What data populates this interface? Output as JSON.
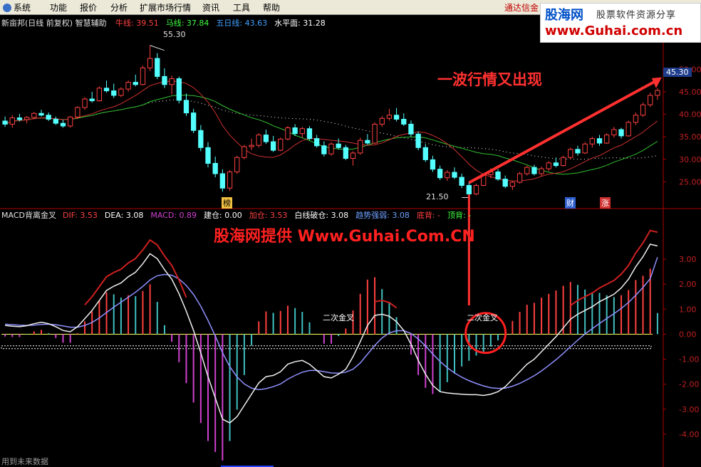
{
  "menu": {
    "items": [
      "系统",
      "功能",
      "报价",
      "分析",
      "扩展市场行情",
      "资讯",
      "工具",
      "帮助"
    ],
    "brand": "通达信金"
  },
  "watermark": {
    "line1": "股海网",
    "line2": "股票软件资源分享",
    "line3": "www.Guhai.com.cn"
  },
  "price_panel": {
    "stock": "新亩邦(日线 前复权) 智慧辅助",
    "indicators": [
      {
        "name": "牛线:",
        "value": "39.51",
        "color": "#ff4040"
      },
      {
        "name": "马线:",
        "value": "37.84",
        "color": "#40ff40"
      },
      {
        "name": "五日线:",
        "value": "43.63",
        "color": "#40a0ff"
      },
      {
        "name": "水平面:",
        "value": "31.28",
        "color": "#ffffff"
      }
    ],
    "high_label": "55.30",
    "low_label": "21.50",
    "current_price": "45.30",
    "marker_bang": "榜",
    "marker_cai": "财",
    "marker_zhang": "涨",
    "annotation": "一波行情又出现"
  },
  "macd_panel": {
    "title": "MACD背离金叉",
    "indicators": [
      {
        "name": "DIF:",
        "value": "3.53",
        "color": "#ff4040"
      },
      {
        "name": "DEA:",
        "value": "3.08",
        "color": "#ffffff"
      },
      {
        "name": "MACD:",
        "value": "0.89",
        "color": "#d040d0"
      },
      {
        "name": "建仓:",
        "value": "0.00",
        "color": "#ffffff"
      },
      {
        "name": "加仓:",
        "value": "3.53",
        "color": "#ff4040"
      },
      {
        "name": "白线破仓:",
        "value": "3.08",
        "color": "#ffffff"
      },
      {
        "name": "趋势强弱:",
        "value": "3.08",
        "color": "#6fa0ff"
      },
      {
        "name": "底背:",
        "value": "-",
        "color": "#ff4040"
      },
      {
        "name": "顶背:",
        "value": "-",
        "color": "#40ff40"
      }
    ],
    "label_cross1": "二次金叉",
    "label_cross2": "二次金叉",
    "annotation": "股海网提供 Www.Guhai.Com.CN"
  },
  "footer": "用到未来数据",
  "chart_data": [
    {
      "type": "candlestick",
      "ylim": [
        20,
        57
      ],
      "y_ticks": [
        25.0,
        30.0,
        35.0,
        40.0,
        45.0,
        50.0
      ],
      "ohlc": [
        [
          38.5,
          39.5,
          37.2,
          37.8
        ],
        [
          37.8,
          39.8,
          37,
          39.2
        ],
        [
          39.2,
          40.1,
          38.4,
          38.8
        ],
        [
          38.8,
          39.6,
          38,
          39.3
        ],
        [
          39.3,
          40.5,
          38.9,
          40.2
        ],
        [
          40.2,
          41.0,
          39.5,
          39.8
        ],
        [
          39.8,
          40.4,
          38.5,
          38.9
        ],
        [
          38.9,
          39.5,
          37.6,
          38.0
        ],
        [
          38.0,
          38.8,
          37.0,
          37.4
        ],
        [
          37.4,
          39.6,
          37.0,
          39.4
        ],
        [
          39.4,
          41.8,
          39.0,
          41.5
        ],
        [
          41.5,
          43.8,
          41.0,
          43.4
        ],
        [
          43.4,
          45.0,
          42.6,
          43.0
        ],
        [
          43.0,
          46.2,
          42.8,
          45.8
        ],
        [
          45.8,
          47.5,
          44.8,
          45.2
        ],
        [
          45.2,
          46.8,
          43.6,
          44.2
        ],
        [
          44.2,
          46.0,
          43.8,
          45.6
        ],
        [
          45.6,
          47.5,
          45.0,
          47.1
        ],
        [
          47.1,
          48.8,
          46.2,
          46.6
        ],
        [
          46.6,
          50.8,
          46.4,
          50.3
        ],
        [
          50.3,
          55.3,
          49.6,
          52.4
        ],
        [
          52.4,
          53.6,
          47.8,
          48.4
        ],
        [
          48.4,
          50.2,
          45.8,
          46.6
        ],
        [
          46.6,
          48.6,
          44.4,
          47.9
        ],
        [
          47.9,
          48.4,
          42.4,
          43.1
        ],
        [
          43.1,
          44.6,
          39.6,
          40.3
        ],
        [
          40.3,
          41.2,
          35.8,
          36.4
        ],
        [
          36.4,
          37.6,
          31.8,
          32.6
        ],
        [
          32.6,
          33.8,
          28.2,
          29.1
        ],
        [
          29.1,
          30.6,
          26.0,
          26.8
        ],
        [
          26.8,
          27.8,
          22.8,
          23.6
        ],
        [
          23.6,
          27.6,
          23.0,
          27.2
        ],
        [
          27.2,
          30.8,
          26.8,
          30.4
        ],
        [
          30.4,
          33.2,
          30.0,
          32.8
        ],
        [
          32.8,
          34.6,
          32.0,
          33.1
        ],
        [
          33.1,
          35.8,
          32.6,
          35.4
        ],
        [
          35.4,
          36.6,
          33.4,
          33.9
        ],
        [
          33.9,
          35.2,
          31.6,
          32.0
        ],
        [
          32.0,
          34.8,
          31.8,
          34.5
        ],
        [
          34.5,
          37.4,
          34.2,
          37.0
        ],
        [
          37.0,
          37.8,
          35.2,
          35.7
        ],
        [
          35.7,
          37.2,
          34.8,
          36.8
        ],
        [
          36.8,
          37.4,
          34.2,
          34.6
        ],
        [
          34.6,
          35.4,
          32.6,
          33.0
        ],
        [
          33.0,
          34.0,
          30.6,
          31.2
        ],
        [
          31.2,
          33.8,
          30.8,
          33.4
        ],
        [
          33.4,
          34.6,
          32.2,
          32.6
        ],
        [
          32.6,
          33.2,
          29.8,
          30.2
        ],
        [
          30.2,
          31.8,
          28.6,
          31.4
        ],
        [
          31.4,
          34.8,
          31.0,
          34.2
        ],
        [
          34.2,
          35.6,
          33.2,
          33.6
        ],
        [
          33.6,
          38.2,
          33.4,
          37.8
        ],
        [
          37.8,
          39.6,
          37.2,
          39.1
        ],
        [
          39.1,
          41.2,
          38.6,
          39.8
        ],
        [
          39.8,
          41.4,
          38.4,
          38.9
        ],
        [
          38.9,
          40.2,
          37.4,
          37.8
        ],
        [
          37.8,
          38.6,
          35.0,
          35.6
        ],
        [
          35.6,
          36.2,
          32.0,
          32.6
        ],
        [
          32.6,
          33.4,
          29.4,
          29.9
        ],
        [
          29.9,
          30.8,
          27.2,
          27.8
        ],
        [
          27.8,
          28.6,
          25.4,
          25.9
        ],
        [
          25.9,
          27.6,
          25.2,
          27.1
        ],
        [
          27.1,
          28.2,
          25.6,
          26.0
        ],
        [
          26.0,
          26.8,
          23.6,
          24.2
        ],
        [
          24.2,
          25.0,
          21.5,
          22.3
        ],
        [
          22.3,
          24.6,
          22.0,
          24.2
        ],
        [
          24.2,
          26.8,
          24.0,
          26.6
        ],
        [
          26.6,
          28.0,
          25.8,
          27.2
        ],
        [
          27.2,
          27.8,
          25.2,
          25.6
        ],
        [
          25.6,
          26.4,
          23.6,
          24.0
        ],
        [
          24.0,
          25.2,
          23.2,
          24.9
        ],
        [
          24.9,
          27.2,
          24.6,
          26.8
        ],
        [
          26.8,
          28.6,
          26.4,
          28.2
        ],
        [
          28.2,
          28.8,
          26.4,
          26.8
        ],
        [
          26.8,
          28.4,
          26.2,
          27.9
        ],
        [
          27.9,
          29.6,
          27.4,
          29.2
        ],
        [
          29.2,
          30.4,
          28.2,
          28.6
        ],
        [
          28.6,
          30.8,
          28.4,
          30.4
        ],
        [
          30.4,
          32.6,
          30.0,
          32.2
        ],
        [
          32.2,
          33.0,
          30.8,
          31.4
        ],
        [
          31.4,
          33.8,
          31.2,
          33.4
        ],
        [
          33.4,
          35.0,
          32.6,
          34.6
        ],
        [
          34.6,
          35.4,
          33.0,
          33.6
        ],
        [
          33.6,
          35.8,
          33.4,
          35.4
        ],
        [
          35.4,
          37.2,
          34.8,
          36.6
        ],
        [
          36.6,
          37.0,
          34.6,
          35.2
        ],
        [
          35.2,
          38.6,
          35.0,
          38.2
        ],
        [
          38.2,
          40.4,
          37.6,
          39.8
        ],
        [
          39.8,
          42.6,
          39.4,
          42.1
        ],
        [
          42.1,
          44.8,
          41.6,
          44.2
        ],
        [
          44.2,
          45.8,
          43.2,
          45.3
        ]
      ]
    },
    {
      "type": "line",
      "ylim": [
        -5.0,
        4.0
      ],
      "y_ticks": [
        -4.0,
        -3.0,
        -2.0,
        -1.0,
        0.0,
        1.0,
        2.0,
        3.0
      ],
      "series": [
        {
          "name": "DIF",
          "values": [
            0.35,
            0.32,
            0.3,
            0.34,
            0.42,
            0.48,
            0.42,
            0.3,
            0.15,
            0.1,
            0.3,
            0.62,
            0.95,
            1.35,
            1.75,
            1.92,
            2.05,
            2.3,
            2.48,
            2.82,
            3.22,
            3.02,
            2.58,
            2.2,
            1.62,
            0.92,
            0.15,
            -0.75,
            -1.7,
            -2.55,
            -3.4,
            -3.55,
            -3.3,
            -2.85,
            -2.4,
            -1.95,
            -1.7,
            -1.65,
            -1.5,
            -1.2,
            -1.1,
            -1.05,
            -1.2,
            -1.45,
            -1.7,
            -1.75,
            -1.6,
            -1.4,
            -0.9,
            -0.3,
            0.35,
            0.75,
            0.8,
            0.72,
            0.5,
            0.15,
            -0.4,
            -1.05,
            -1.6,
            -2.05,
            -2.3,
            -2.35,
            -2.38,
            -2.4,
            -2.42,
            -2.42,
            -2.45,
            -2.4,
            -2.3,
            -2.1,
            -1.8,
            -1.5,
            -1.2,
            -1.0,
            -0.7,
            -0.4,
            -0.1,
            0.25,
            0.6,
            0.8,
            0.95,
            1.1,
            1.3,
            1.45,
            1.6,
            1.85,
            2.2,
            2.7,
            3.1,
            3.6,
            3.53
          ]
        },
        {
          "name": "DEA",
          "values": [
            0.4,
            0.38,
            0.36,
            0.35,
            0.36,
            0.39,
            0.4,
            0.38,
            0.33,
            0.28,
            0.28,
            0.35,
            0.47,
            0.65,
            0.87,
            1.08,
            1.28,
            1.48,
            1.68,
            1.91,
            2.17,
            2.34,
            2.39,
            2.36,
            2.21,
            1.95,
            1.59,
            1.12,
            0.55,
            -0.07,
            -0.74,
            -1.3,
            -1.71,
            -1.99,
            -2.16,
            -2.22,
            -2.18,
            -2.1,
            -1.99,
            -1.8,
            -1.65,
            -1.52,
            -1.45,
            -1.45,
            -1.5,
            -1.55,
            -1.56,
            -1.52,
            -1.4,
            -1.15,
            -0.8,
            -0.45,
            -0.15,
            0.05,
            0.14,
            0.14,
            0.03,
            -0.19,
            -0.47,
            -0.79,
            -1.09,
            -1.34,
            -1.55,
            -1.72,
            -1.86,
            -1.97,
            -2.07,
            -2.14,
            -2.17,
            -2.16,
            -2.08,
            -1.97,
            -1.82,
            -1.66,
            -1.47,
            -1.25,
            -1.02,
            -0.77,
            -0.5,
            -0.24,
            0.01,
            0.22,
            0.43,
            0.63,
            0.82,
            1.03,
            1.27,
            1.56,
            1.87,
            2.22,
            3.08
          ]
        },
        {
          "name": "MACD",
          "values": [
            -0.1,
            -0.12,
            -0.12,
            -0.02,
            0.12,
            0.18,
            0.04,
            -0.16,
            -0.36,
            -0.36,
            0.04,
            0.54,
            0.96,
            1.4,
            1.76,
            1.68,
            1.54,
            1.64,
            1.6,
            1.82,
            2.1,
            1.36,
            0.38,
            -0.32,
            -1.18,
            -2.06,
            -2.88,
            -3.74,
            -4.5,
            -4.96,
            -5.32,
            -4.5,
            -3.18,
            -1.72,
            -0.48,
            0.54,
            0.96,
            0.9,
            0.98,
            1.2,
            1.1,
            0.94,
            0.5,
            0.0,
            -0.4,
            -0.4,
            -0.08,
            0.24,
            1.0,
            1.7,
            2.3,
            2.4,
            1.9,
            1.34,
            0.72,
            0.02,
            -0.86,
            -1.72,
            -2.26,
            -2.52,
            -2.42,
            -2.02,
            -1.66,
            -1.36,
            -1.12,
            -0.9,
            -0.76,
            -0.52,
            -0.26,
            0.12,
            0.56,
            0.94,
            1.24,
            1.32,
            1.54,
            1.7,
            1.84,
            2.04,
            2.2,
            2.08,
            1.88,
            1.76,
            1.74,
            1.64,
            1.56,
            1.64,
            1.86,
            2.28,
            2.46,
            2.76,
            0.89
          ]
        }
      ]
    }
  ]
}
